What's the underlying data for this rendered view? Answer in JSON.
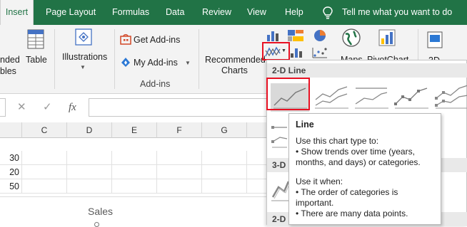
{
  "tabs": [
    {
      "label": "Insert",
      "active": true
    },
    {
      "label": "Page Layout"
    },
    {
      "label": "Formulas"
    },
    {
      "label": "Data"
    },
    {
      "label": "Review"
    },
    {
      "label": "View"
    },
    {
      "label": "Help"
    }
  ],
  "tell_me": "Tell me what you want to do",
  "ribbon": {
    "recommended_pivot_partial": [
      "nded",
      "bles"
    ],
    "table": "Table",
    "illustrations": "Illustrations",
    "get_addins": "Get Add-ins",
    "my_addins": "My Add-ins",
    "addins_group": "Add-ins",
    "recommended_charts": [
      "Recommended",
      "Charts"
    ],
    "maps_partial": "Maps",
    "pivotchart_partial": "PivotChart",
    "threed_partial": "3D"
  },
  "formula_bar": {
    "cancel": "✕",
    "enter": "✓",
    "fx": "fx",
    "value": ""
  },
  "columns": [
    "C",
    "D",
    "E",
    "F",
    "G"
  ],
  "rows": [
    {
      "b": "30"
    },
    {
      "b": "20"
    },
    {
      "b": "50"
    },
    {
      "b": ""
    }
  ],
  "chart_title_partial": "Sales",
  "gallery": {
    "section_2d": "2-D Line",
    "section_3d_partial": "3-D",
    "section_2d_area_partial": "2-D"
  },
  "tooltip": {
    "title": "Line",
    "use_intro": "Use this chart type to:",
    "use_lines": [
      "• Show trends over time (years,",
      "months, and days) or categories."
    ],
    "when_intro": "Use it when:",
    "when_lines": [
      "• The order of categories is",
      "important.",
      "• There are many data points."
    ]
  },
  "colors": {
    "excel_green": "#217346",
    "highlight": "#e81123"
  }
}
